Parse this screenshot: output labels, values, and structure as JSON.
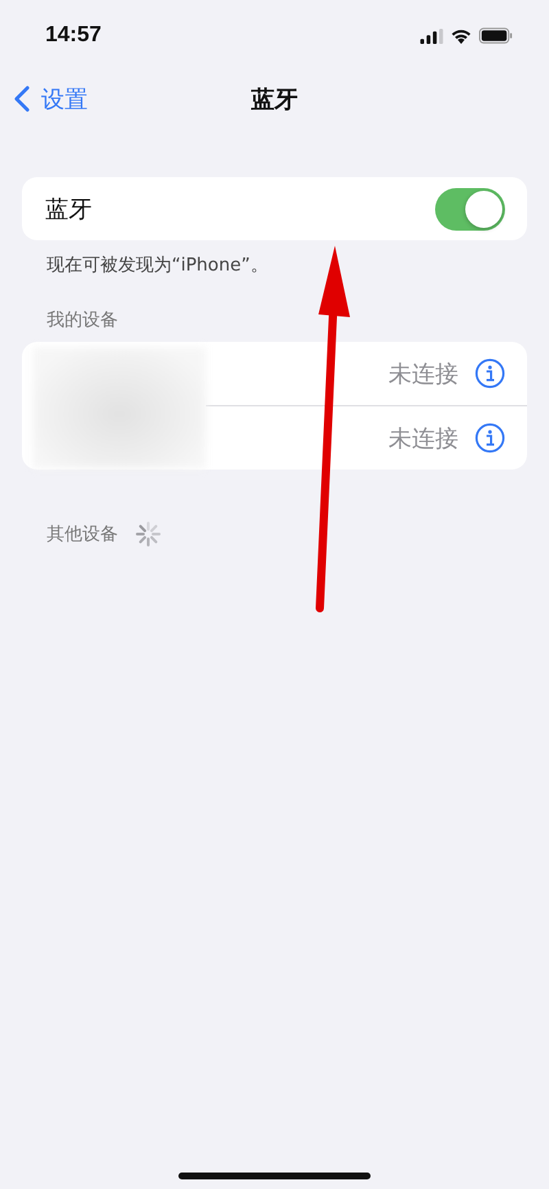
{
  "status_bar": {
    "time": "14:57"
  },
  "nav": {
    "back": "设置",
    "title": "蓝牙"
  },
  "bluetooth": {
    "label": "蓝牙",
    "on": true,
    "footer": "现在可被发现为“iPhone”。"
  },
  "my_devices": {
    "header": "我的设备",
    "devices": [
      {
        "status": "未连接"
      },
      {
        "status": "未连接"
      }
    ]
  },
  "other_devices": {
    "header": "其他设备",
    "searching": true
  }
}
